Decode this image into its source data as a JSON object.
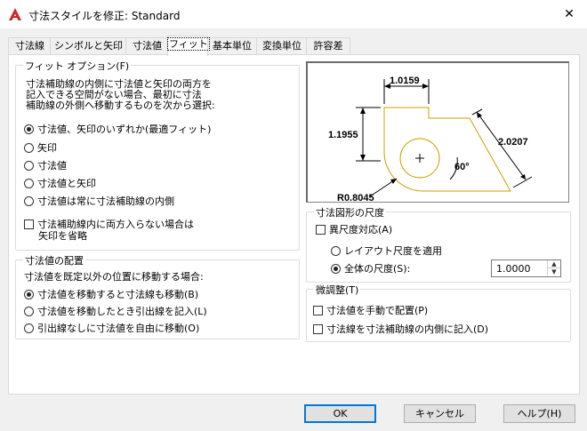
{
  "window": {
    "title": "寸法スタイルを修正: Standard",
    "close_glyph": "✕",
    "icon": "autocad-logo-icon"
  },
  "tabs": [
    {
      "label": "寸法線"
    },
    {
      "label": "シンボルと矢印"
    },
    {
      "label": "寸法値"
    },
    {
      "label": "フィット",
      "active": true
    },
    {
      "label": "基本単位"
    },
    {
      "label": "変換単位"
    },
    {
      "label": "許容差"
    }
  ],
  "fit_options": {
    "title": "フィット オプション(F)",
    "description_lines": [
      "寸法補助線の内側に寸法値と矢印の両方を",
      "記入できる空間がない場合、最初に寸法",
      "補助線の外側へ移動するものを次から選択:"
    ],
    "radios": [
      {
        "label": "寸法値、矢印のいずれか(最適フィット)",
        "selected": true
      },
      {
        "label": "矢印",
        "selected": false
      },
      {
        "label": "寸法値",
        "selected": false
      },
      {
        "label": "寸法値と矢印",
        "selected": false
      },
      {
        "label": "寸法値は常に寸法補助線の内側",
        "selected": false
      }
    ],
    "suppress_check": {
      "line1": "寸法補助線内に両方入らない場合は",
      "line2": "矢印を省略",
      "checked": false
    }
  },
  "text_placement": {
    "title": "寸法値の配置",
    "description": "寸法値を既定以外の位置に移動する場合:",
    "radios": [
      {
        "label": "寸法値を移動すると寸法線も移動(B)",
        "selected": true
      },
      {
        "label": "寸法値を移動したとき引出線を記入(L)",
        "selected": false
      },
      {
        "label": "引出線なしに寸法値を自由に移動(O)",
        "selected": false
      }
    ]
  },
  "preview": {
    "dim_top": "1.0159",
    "dim_left": "1.1955",
    "dim_right": "2.0207",
    "angle": "60°",
    "radius": "R0.8045",
    "center_mark": "+"
  },
  "scale": {
    "title": "寸法図形の尺度",
    "annotative_check": {
      "label": "異尺度対応(A)",
      "checked": false
    },
    "radios": [
      {
        "label": "レイアウト尺度を適用",
        "selected": false
      },
      {
        "label": "全体の尺度(S):",
        "selected": true
      }
    ],
    "overall_scale_value": "1.0000"
  },
  "fine_tuning": {
    "title": "微調整(T)",
    "checks": [
      {
        "label": "寸法値を手動で配置(P)",
        "checked": false
      },
      {
        "label": "寸法線を寸法補助線の内側に記入(D)",
        "checked": false
      }
    ]
  },
  "buttons": {
    "ok": "OK",
    "cancel": "キャンセル",
    "help": "ヘルプ(H)"
  }
}
